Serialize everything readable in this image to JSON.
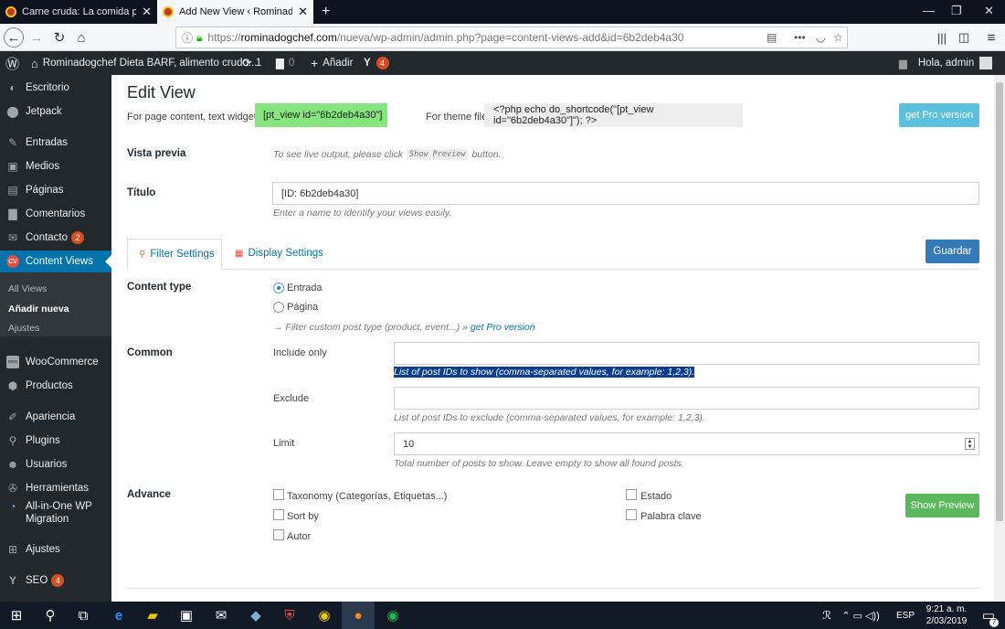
{
  "browser": {
    "tabs": [
      {
        "title": "Carne cruda: La comida para \"r"
      },
      {
        "title": "Add New View ‹ Rominadogch"
      }
    ],
    "new_tab": "+",
    "close_glyph": "✕",
    "window_controls": {
      "minimize": "—",
      "restore": "❐",
      "close": "✕"
    },
    "url_prefix": "https://",
    "url_domain": "rominadogchef.com",
    "url_path": "/nueva/wp-admin/admin.php?page=content-views-add&id=6b2deb4a30",
    "toolbar_right": [
      "library-icon",
      "sidebar-icon",
      "menu-icon"
    ]
  },
  "adminbar": {
    "site_name": "Rominadogchef Dieta BARF, alimento crudo...",
    "updates_count": "1",
    "comments_count": "0",
    "add_new": "Añadir",
    "yoast_count": "4",
    "greeting": "Hola, admin"
  },
  "sidebar": {
    "items": [
      {
        "label": "Escritorio",
        "icon": "dashboard-icon"
      },
      {
        "label": "Jetpack",
        "icon": "jetpack-icon"
      },
      {
        "label": "Entradas",
        "icon": "pin-icon"
      },
      {
        "label": "Medios",
        "icon": "media-icon"
      },
      {
        "label": "Páginas",
        "icon": "pages-icon"
      },
      {
        "label": "Comentarios",
        "icon": "comment-icon"
      },
      {
        "label": "Contacto",
        "icon": "mail-icon",
        "badge": "2"
      },
      {
        "label": "Content Views",
        "icon": "cv-icon",
        "icon_text": "CV"
      },
      {
        "label": "WooCommerce",
        "icon": "woo-icon",
        "icon_text": "woo"
      },
      {
        "label": "Productos",
        "icon": "box-icon"
      },
      {
        "label": "Apariencia",
        "icon": "brush-icon"
      },
      {
        "label": "Plugins",
        "icon": "plugin-icon"
      },
      {
        "label": "Usuarios",
        "icon": "user-icon"
      },
      {
        "label": "Herramientas",
        "icon": "wrench-icon"
      },
      {
        "label": "All-in-One WP",
        "label2": "Migration",
        "icon": "migration-icon"
      },
      {
        "label": "Ajustes",
        "icon": "settings-icon"
      },
      {
        "label": "SEO",
        "icon": "yoast-icon",
        "badge": "4"
      }
    ],
    "submenu": [
      "All Views",
      "Añadir nueva",
      "Ajustes"
    ]
  },
  "page": {
    "title": "Edit View",
    "shortcode_label": "For page content, text widget...",
    "shortcode": "[pt_view id=\"6b2deb4a30\"]",
    "theme_label": "For theme file",
    "theme_code": "<?php echo do_shortcode(\"[pt_view id=\"6b2deb4a30\"]\"); ?>",
    "pro_button": "get Pro version",
    "preview_label": "Vista previa",
    "preview_hint_before": "To see live output, please click",
    "preview_hint_code": "Show Preview",
    "preview_hint_after": "button.",
    "title_label": "Título",
    "title_value": "[ID: 6b2deb4a30]",
    "title_hint": "Enter a name to identify your views easily.",
    "tabs": [
      "Filter Settings",
      "Display Settings"
    ],
    "save_button": "Guardar",
    "content_type_label": "Content type",
    "content_types": [
      "Entrada",
      "Página"
    ],
    "filter_hint": "→ Filter custom post type (product, event...) »",
    "filter_hint_link": "get Pro version",
    "common_label": "Common",
    "include_label": "Include only",
    "include_value": "",
    "include_hint": "List of post IDs to show (comma-separated values, for example: 1,2,3).",
    "exclude_label": "Exclude",
    "exclude_value": "",
    "exclude_hint": "List of post IDs to exclude (comma-separated values, for example: 1,2,3).",
    "limit_label": "Limit",
    "limit_value": "10",
    "limit_hint": "Total number of posts to show. Leave empty to show all found posts.",
    "advance_label": "Advance",
    "advance_options_left": [
      "Taxonomy (Categorías, Etiquetas...)",
      "Sort by",
      "Autor"
    ],
    "advance_options_right": [
      "Estado",
      "Palabra clave"
    ],
    "show_preview": "Show Preview"
  },
  "taskbar": {
    "lang": "ESP",
    "time": "9:21 a. m.",
    "date": "2/03/2019",
    "notif": "7"
  },
  "colors": {
    "admin_dark": "#23282d",
    "wp_blue": "#0073aa",
    "green_code": "#86e57f",
    "pro_button": "#5bc0de",
    "save_button": "#337ab7",
    "preview_button": "#5cb85c",
    "highlight": "#0a3e8f"
  }
}
